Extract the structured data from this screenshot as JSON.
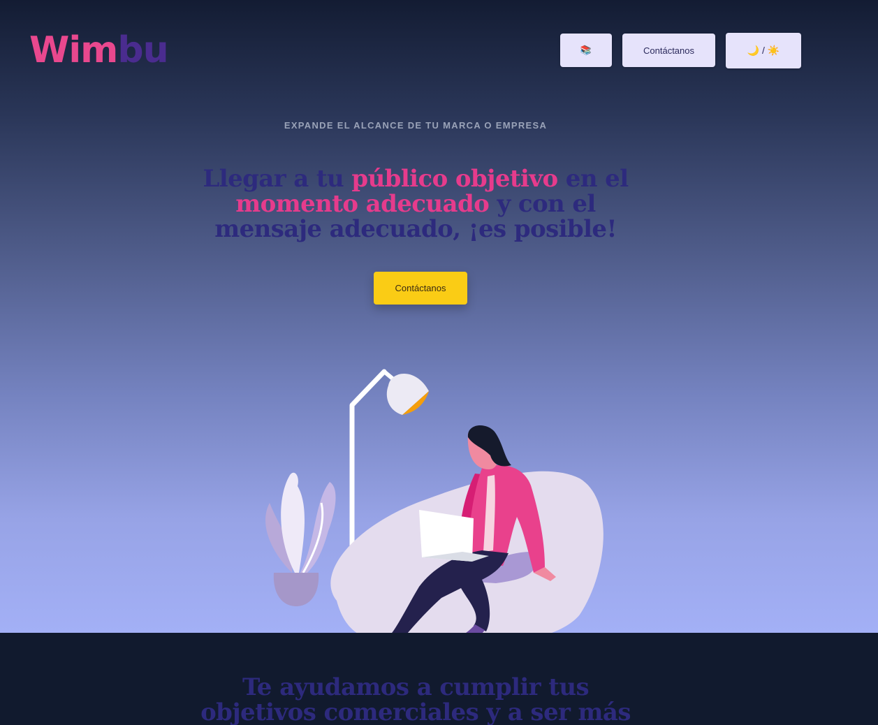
{
  "header": {
    "logo_part1": "Wim",
    "logo_part2": "bu",
    "menu_icon": "📚",
    "contact_label": "Contáctanos",
    "theme_toggle": "🌙 / ☀️"
  },
  "hero": {
    "eyebrow": "EXPANDE EL ALCANCE DE TU MARCA O EMPRESA",
    "headline_part1": "Llegar a tu ",
    "headline_hl1": "público objetivo",
    "headline_part2": " en el ",
    "headline_hl2": "momento adecuado",
    "headline_part3": " y con el mensaje adecuado, ¡es posible!",
    "cta_label": "Contáctanos"
  },
  "section": {
    "title": "Te ayudamos a cumplir tus objetivos comerciales y a ser más competitivo"
  },
  "colors": {
    "brand_pink": "#e63b8c",
    "brand_purple": "#4a2c8f",
    "cta_yellow": "#facc15",
    "button_lavender": "#e6e3fb",
    "dark_bg": "#111a2e"
  }
}
